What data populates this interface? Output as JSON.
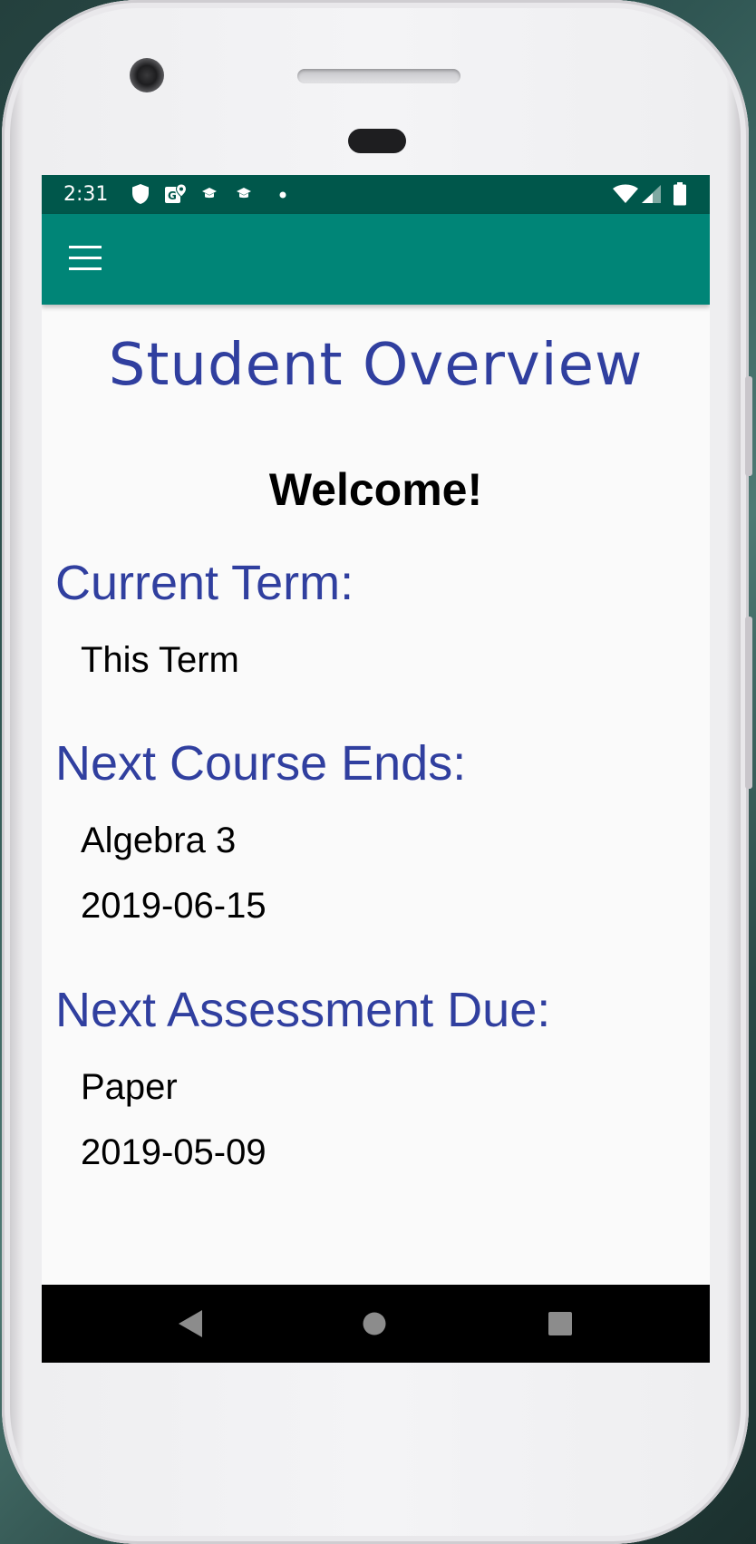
{
  "status_bar": {
    "time": "2:31",
    "icons": [
      "shield-icon",
      "map-gps-icon",
      "school-icon",
      "school-icon",
      "notification-dot-icon",
      "wifi-icon",
      "cell-signal-icon",
      "battery-icon"
    ]
  },
  "app_bar": {
    "menu_icon": "hamburger-menu-icon"
  },
  "main": {
    "title": "Student Overview",
    "welcome": "Welcome!",
    "current_term": {
      "heading": "Current Term:",
      "term_name": "This Term"
    },
    "next_course": {
      "heading": "Next Course Ends:",
      "course_name": "Algebra 3",
      "end_date": "2019-06-15"
    },
    "next_assessment": {
      "heading": "Next Assessment Due:",
      "assessment_name": "Paper",
      "due_date": "2019-05-09"
    }
  },
  "nav_bar": {
    "buttons": [
      "back-icon",
      "home-icon",
      "recents-icon"
    ]
  },
  "colors": {
    "status_bar": "#00574b",
    "app_bar": "#008577",
    "accent_text": "#303f9f",
    "background": "#fafafa",
    "nav_bar": "#000000"
  }
}
